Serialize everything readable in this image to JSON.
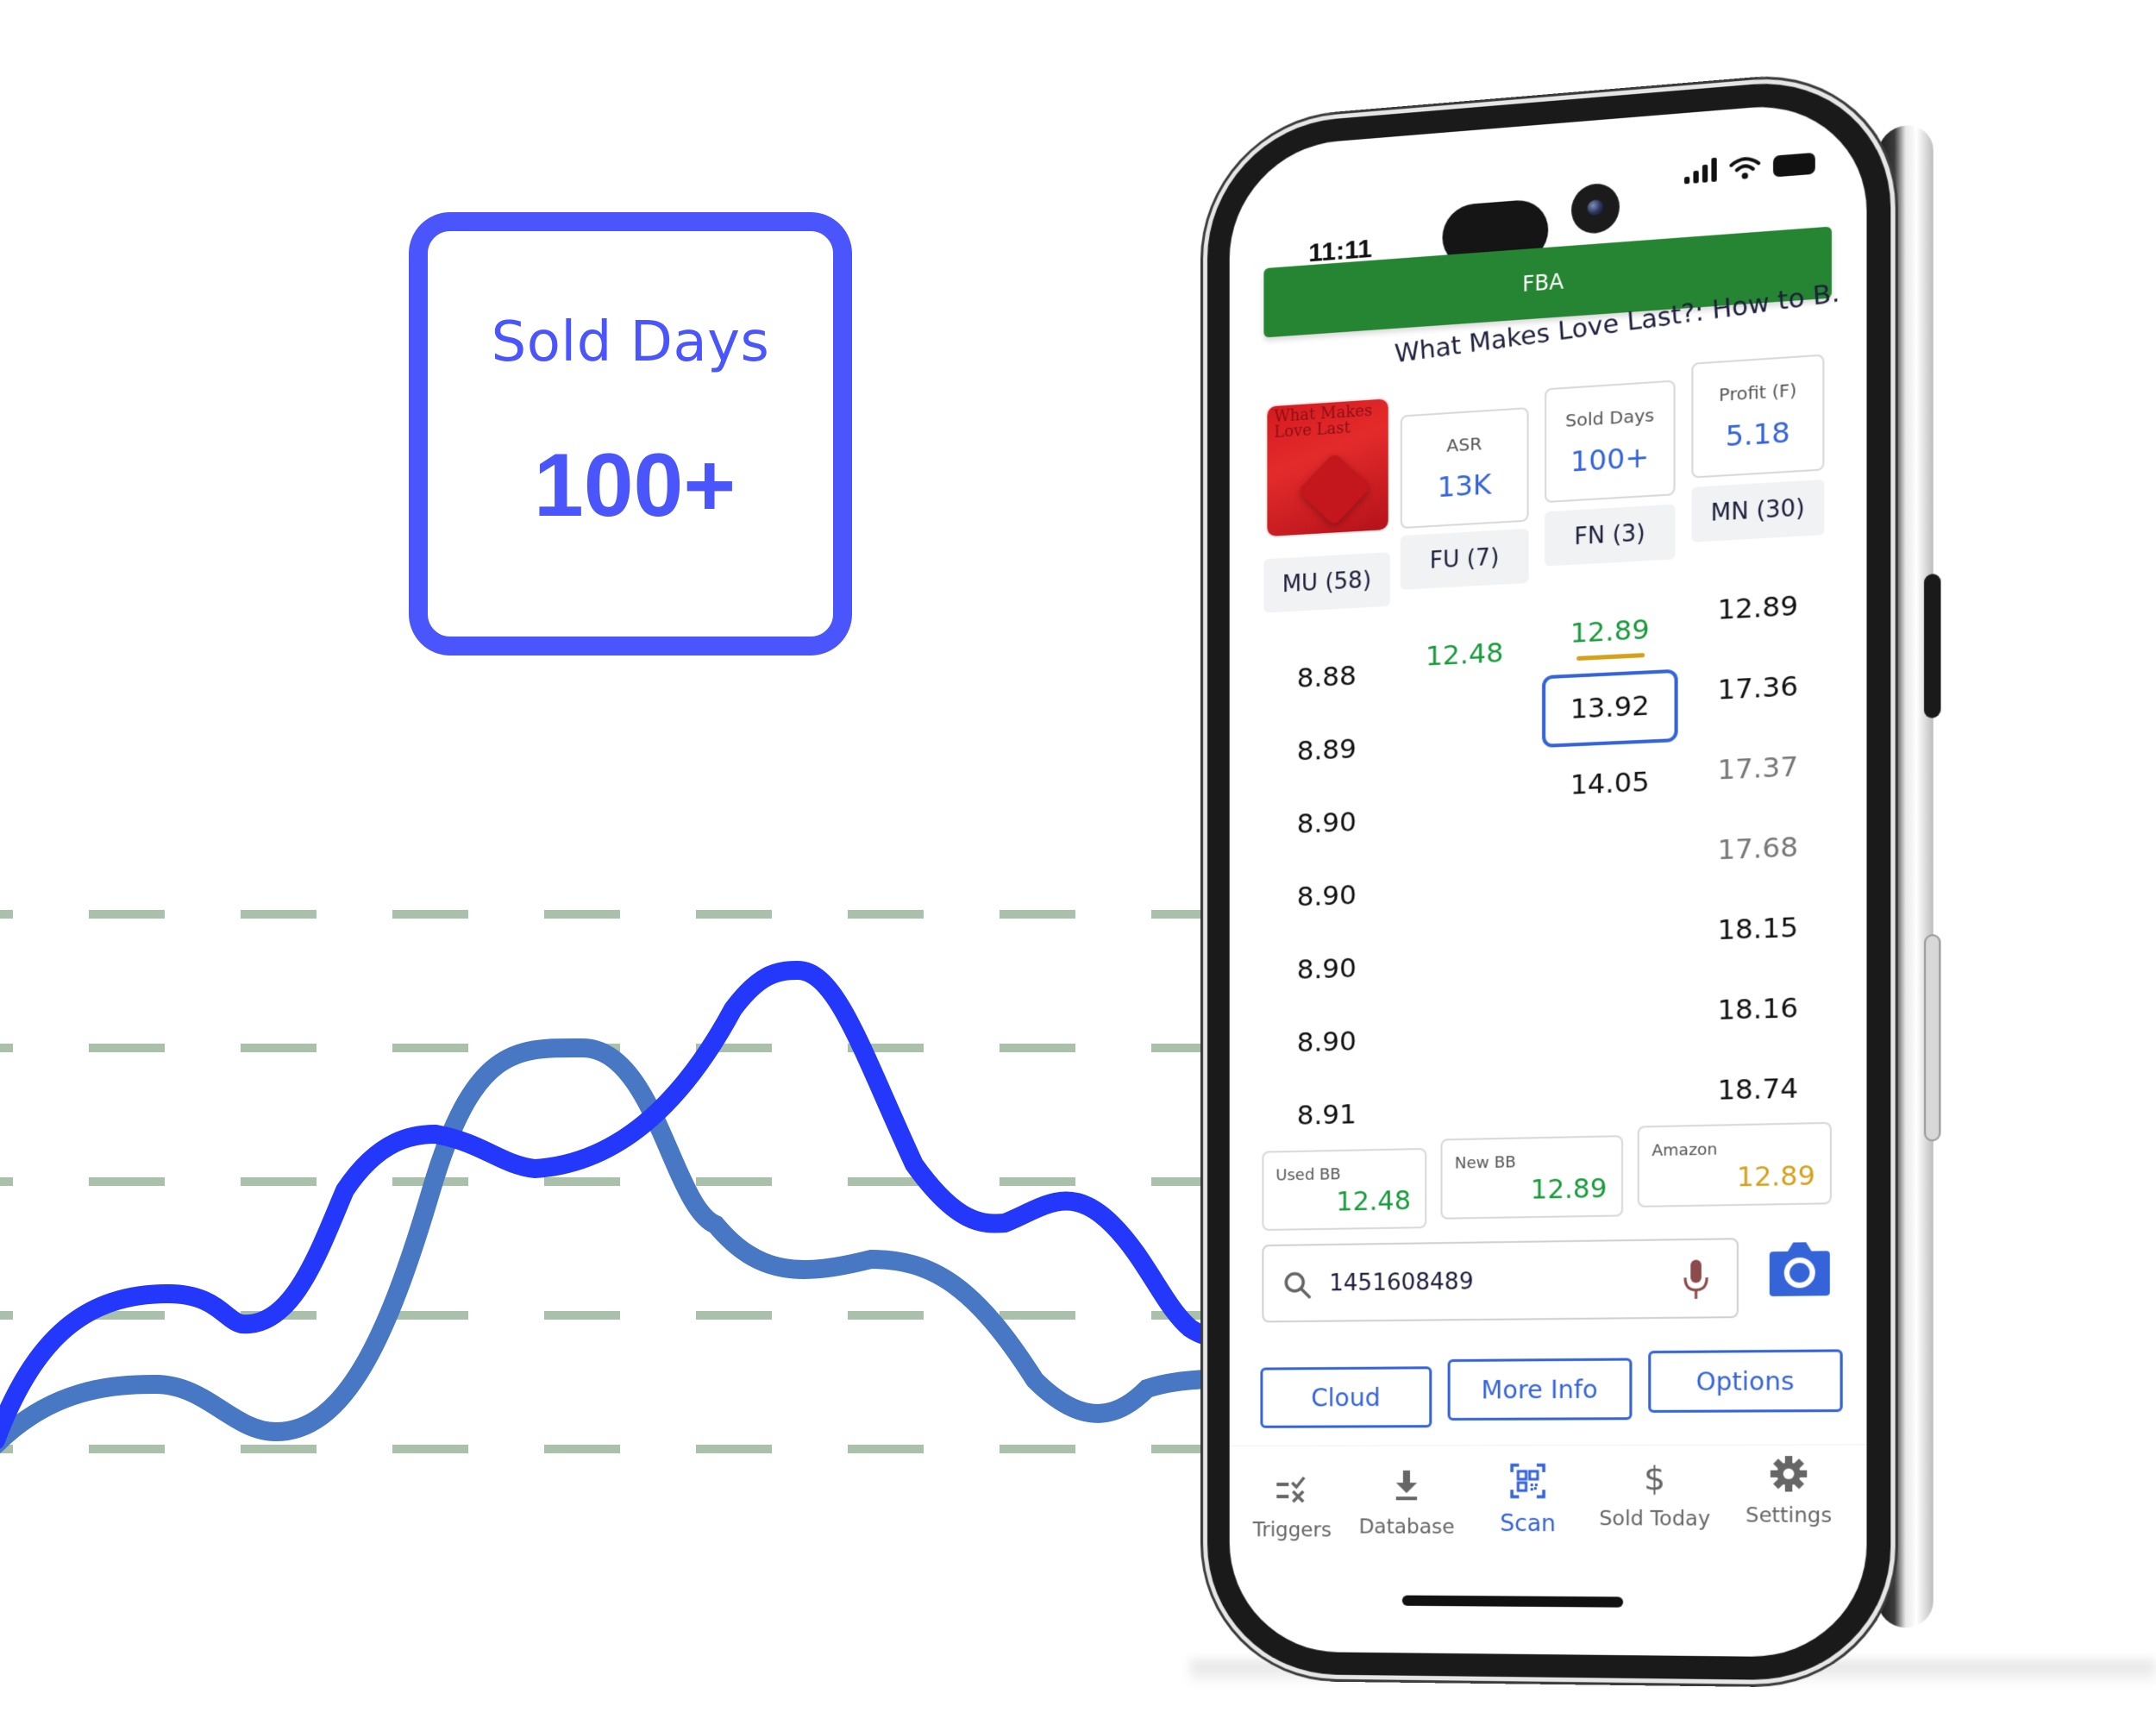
{
  "feature_card": {
    "label": "Sold Days",
    "value": "100+",
    "color": "#4a55fb"
  },
  "decor_chart": {
    "series": [
      {
        "name": "line-1",
        "color": "#2438fb"
      },
      {
        "name": "line-2",
        "color": "#4878c4"
      }
    ],
    "gridline_color": "#a9c0ab"
  },
  "status_bar": {
    "time": "11:11",
    "icons": [
      "signal-icon",
      "wifi-icon",
      "battery-icon"
    ]
  },
  "header": {
    "mode_label": "FBA",
    "mode_color": "#268532"
  },
  "product": {
    "title": "What Makes Love Last?: How to B...",
    "cover_alt": "What Makes Love Last",
    "stats": [
      {
        "label": "ASR",
        "value": "13K"
      },
      {
        "label": "Sold Days",
        "value": "100+"
      },
      {
        "label": "Profit (F)",
        "value": "5.18"
      }
    ]
  },
  "offers": {
    "columns": [
      {
        "label": "MU (58)",
        "prices": [
          "8.88",
          "8.89",
          "8.90",
          "8.90",
          "8.90",
          "8.90",
          "8.91"
        ]
      },
      {
        "label": "FU (7)",
        "prices": [
          "12.48"
        ]
      },
      {
        "label": "FN (3)",
        "prices": [
          "12.89",
          "13.92",
          "14.05"
        ]
      },
      {
        "label": "MN (30)",
        "prices": [
          "12.89",
          "17.36",
          "17.37",
          "17.68",
          "18.15",
          "18.16",
          "18.74"
        ]
      }
    ],
    "selected_price": "13.92"
  },
  "buybox": [
    {
      "label": "Used BB",
      "value": "12.48"
    },
    {
      "label": "New BB",
      "value": "12.89"
    },
    {
      "label": "Amazon",
      "value": "12.89"
    }
  ],
  "search": {
    "value": "1451608489",
    "placeholder": ""
  },
  "actions": {
    "cloud": "Cloud",
    "more_info": "More Info",
    "options": "Options"
  },
  "tabs": [
    {
      "label": "Triggers",
      "icon": "triggers-icon"
    },
    {
      "label": "Database",
      "icon": "download-icon"
    },
    {
      "label": "Scan",
      "icon": "qr-scan-icon",
      "active": true
    },
    {
      "label": "Sold Today",
      "icon": "dollar-icon"
    },
    {
      "label": "Settings",
      "icon": "gear-icon"
    }
  ],
  "colors": {
    "accent_blue": "#3464d8",
    "price_green": "#199a3c",
    "price_gold": "#d4a11b"
  }
}
